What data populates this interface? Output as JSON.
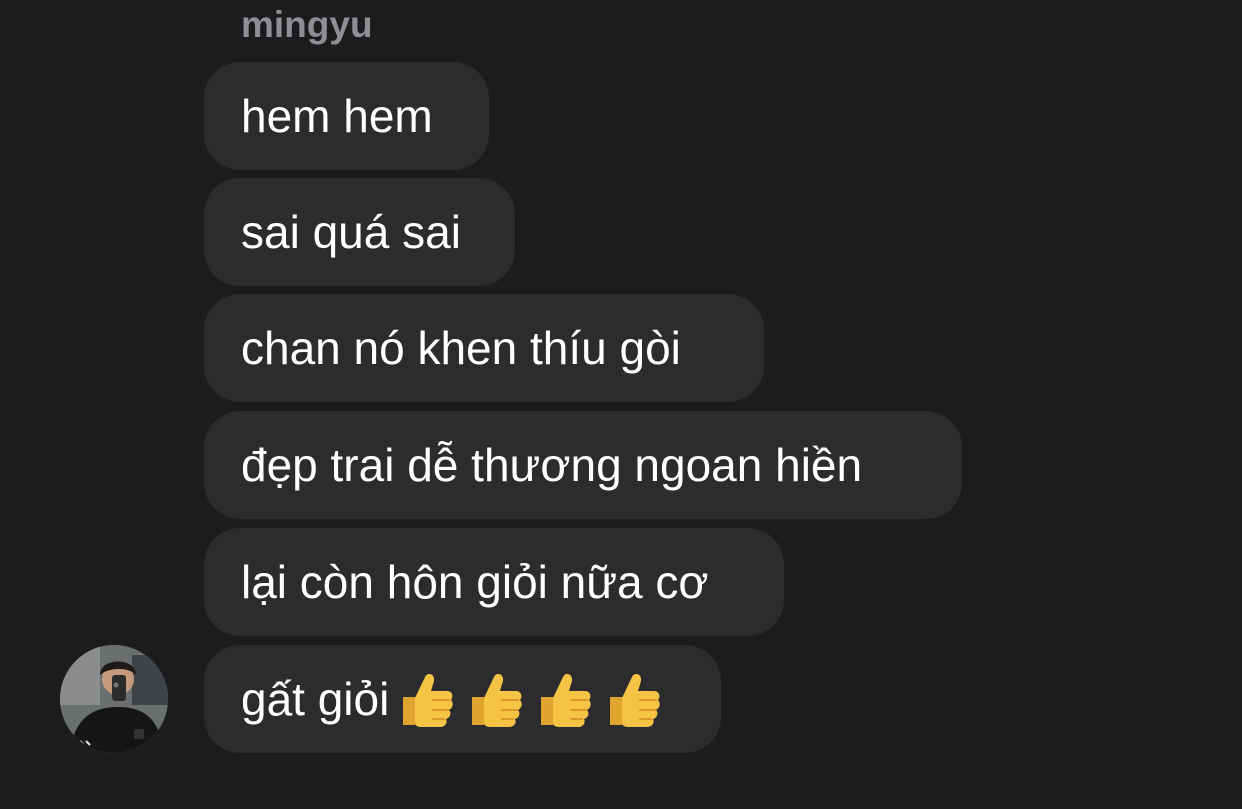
{
  "conversation": {
    "sender": "mingyu",
    "messages": [
      {
        "text": "hem hem"
      },
      {
        "text": "sai quá sai"
      },
      {
        "text": "chan nó khen thíu gòi"
      },
      {
        "text": "đẹp trai dễ thương ngoan hiền"
      },
      {
        "text": "lại còn hôn giỏi nữa cơ"
      },
      {
        "text": "gất giỏi",
        "emoji_count": 4,
        "emoji": "thumbs-up"
      }
    ]
  },
  "colors": {
    "background": "#1c1c1e",
    "bubble": "#2c2c2e",
    "text": "#ffffff",
    "sender": "#8e8e93",
    "emoji": "#f6c444"
  }
}
